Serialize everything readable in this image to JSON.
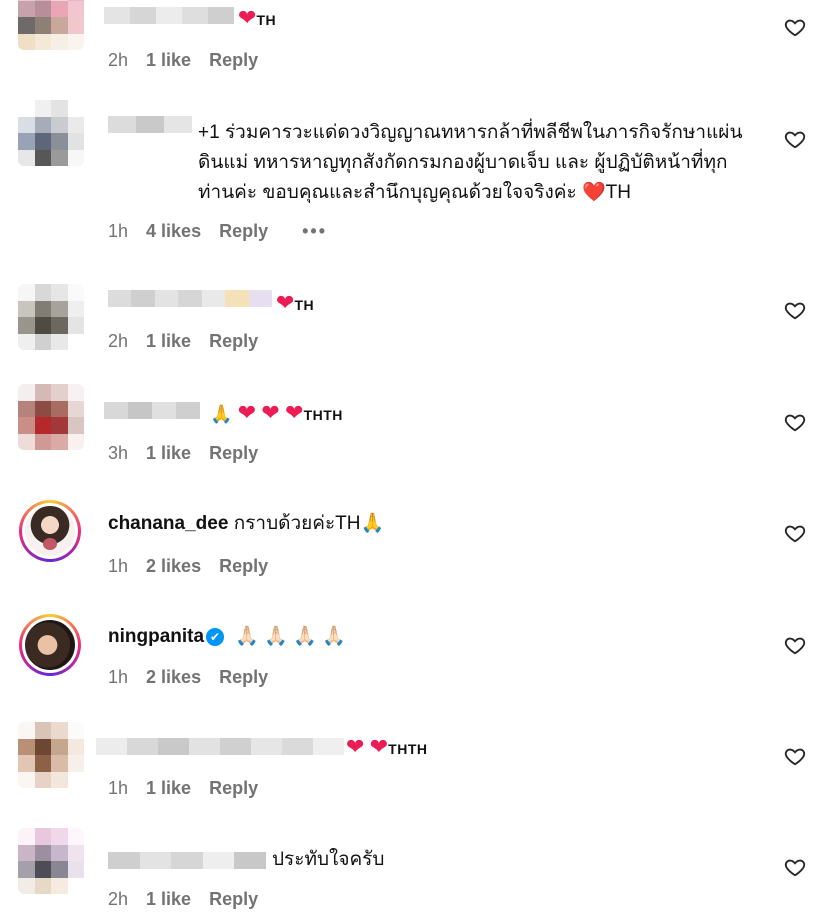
{
  "comments": [
    {
      "text": "❤️TH",
      "time": "2h",
      "likes": "1 like",
      "reply": "Reply"
    },
    {
      "text": "+1 ร่วมคารวะแด่ดวงวิญญาณทหารกล้าที่พลีชีพในภารกิจรักษาแผ่นดินแม่ ทหารหาญทุกสังกัดกรมกองผู้บาดเจ็บ และ ผู้ปฏิบัติหน้าที่ทุกท่านค่ะ ขอบคุณและสำนึกบุญคุณด้วยใจจริงค่ะ ❤️TH",
      "time": "1h",
      "likes": "4 likes",
      "reply": "Reply",
      "more": "•••"
    },
    {
      "text": "🙏 ❤️TH",
      "time": "2h",
      "likes": "1 like",
      "reply": "Reply"
    },
    {
      "text": "🙏 ❤️ ❤️ ❤️THTH",
      "time": "3h",
      "likes": "1 like",
      "reply": "Reply"
    },
    {
      "username": "chanana_dee",
      "text": "กราบด้วยค่ะTH🙏",
      "time": "1h",
      "likes": "2 likes",
      "reply": "Reply"
    },
    {
      "username": "ningpanita",
      "verified": "✔",
      "text": "🙏🏻 🙏🏻 🙏🏻 🙏🏻",
      "time": "1h",
      "likes": "2 likes",
      "reply": "Reply"
    },
    {
      "text": "❤️ ❤️THTH",
      "time": "1h",
      "likes": "1 like",
      "reply": "Reply"
    },
    {
      "text": "ประทับใจครับ",
      "time": "2h",
      "likes": "1 like",
      "reply": "Reply"
    }
  ],
  "icons": {
    "like": "heart-outline-icon",
    "verified": "verified-badge-icon"
  },
  "colors": {
    "heart": "#ed1c55",
    "meta": "#737373",
    "verified": "#0095f6"
  }
}
